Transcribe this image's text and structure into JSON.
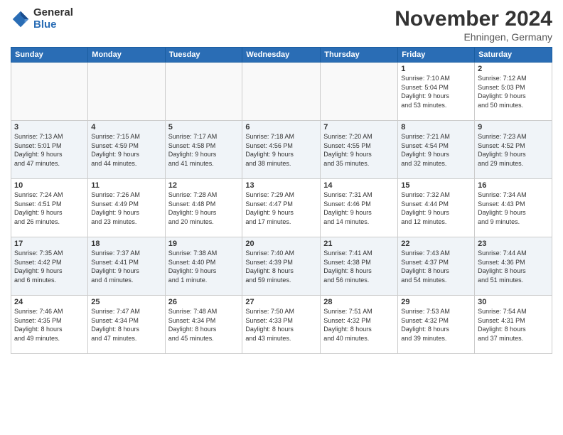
{
  "logo": {
    "general": "General",
    "blue": "Blue"
  },
  "title": "November 2024",
  "location": "Ehningen, Germany",
  "headers": [
    "Sunday",
    "Monday",
    "Tuesday",
    "Wednesday",
    "Thursday",
    "Friday",
    "Saturday"
  ],
  "weeks": [
    {
      "shaded": false,
      "days": [
        {
          "num": "",
          "info": ""
        },
        {
          "num": "",
          "info": ""
        },
        {
          "num": "",
          "info": ""
        },
        {
          "num": "",
          "info": ""
        },
        {
          "num": "",
          "info": ""
        },
        {
          "num": "1",
          "info": "Sunrise: 7:10 AM\nSunset: 5:04 PM\nDaylight: 9 hours\nand 53 minutes."
        },
        {
          "num": "2",
          "info": "Sunrise: 7:12 AM\nSunset: 5:03 PM\nDaylight: 9 hours\nand 50 minutes."
        }
      ]
    },
    {
      "shaded": true,
      "days": [
        {
          "num": "3",
          "info": "Sunrise: 7:13 AM\nSunset: 5:01 PM\nDaylight: 9 hours\nand 47 minutes."
        },
        {
          "num": "4",
          "info": "Sunrise: 7:15 AM\nSunset: 4:59 PM\nDaylight: 9 hours\nand 44 minutes."
        },
        {
          "num": "5",
          "info": "Sunrise: 7:17 AM\nSunset: 4:58 PM\nDaylight: 9 hours\nand 41 minutes."
        },
        {
          "num": "6",
          "info": "Sunrise: 7:18 AM\nSunset: 4:56 PM\nDaylight: 9 hours\nand 38 minutes."
        },
        {
          "num": "7",
          "info": "Sunrise: 7:20 AM\nSunset: 4:55 PM\nDaylight: 9 hours\nand 35 minutes."
        },
        {
          "num": "8",
          "info": "Sunrise: 7:21 AM\nSunset: 4:54 PM\nDaylight: 9 hours\nand 32 minutes."
        },
        {
          "num": "9",
          "info": "Sunrise: 7:23 AM\nSunset: 4:52 PM\nDaylight: 9 hours\nand 29 minutes."
        }
      ]
    },
    {
      "shaded": false,
      "days": [
        {
          "num": "10",
          "info": "Sunrise: 7:24 AM\nSunset: 4:51 PM\nDaylight: 9 hours\nand 26 minutes."
        },
        {
          "num": "11",
          "info": "Sunrise: 7:26 AM\nSunset: 4:49 PM\nDaylight: 9 hours\nand 23 minutes."
        },
        {
          "num": "12",
          "info": "Sunrise: 7:28 AM\nSunset: 4:48 PM\nDaylight: 9 hours\nand 20 minutes."
        },
        {
          "num": "13",
          "info": "Sunrise: 7:29 AM\nSunset: 4:47 PM\nDaylight: 9 hours\nand 17 minutes."
        },
        {
          "num": "14",
          "info": "Sunrise: 7:31 AM\nSunset: 4:46 PM\nDaylight: 9 hours\nand 14 minutes."
        },
        {
          "num": "15",
          "info": "Sunrise: 7:32 AM\nSunset: 4:44 PM\nDaylight: 9 hours\nand 12 minutes."
        },
        {
          "num": "16",
          "info": "Sunrise: 7:34 AM\nSunset: 4:43 PM\nDaylight: 9 hours\nand 9 minutes."
        }
      ]
    },
    {
      "shaded": true,
      "days": [
        {
          "num": "17",
          "info": "Sunrise: 7:35 AM\nSunset: 4:42 PM\nDaylight: 9 hours\nand 6 minutes."
        },
        {
          "num": "18",
          "info": "Sunrise: 7:37 AM\nSunset: 4:41 PM\nDaylight: 9 hours\nand 4 minutes."
        },
        {
          "num": "19",
          "info": "Sunrise: 7:38 AM\nSunset: 4:40 PM\nDaylight: 9 hours\nand 1 minute."
        },
        {
          "num": "20",
          "info": "Sunrise: 7:40 AM\nSunset: 4:39 PM\nDaylight: 8 hours\nand 59 minutes."
        },
        {
          "num": "21",
          "info": "Sunrise: 7:41 AM\nSunset: 4:38 PM\nDaylight: 8 hours\nand 56 minutes."
        },
        {
          "num": "22",
          "info": "Sunrise: 7:43 AM\nSunset: 4:37 PM\nDaylight: 8 hours\nand 54 minutes."
        },
        {
          "num": "23",
          "info": "Sunrise: 7:44 AM\nSunset: 4:36 PM\nDaylight: 8 hours\nand 51 minutes."
        }
      ]
    },
    {
      "shaded": false,
      "days": [
        {
          "num": "24",
          "info": "Sunrise: 7:46 AM\nSunset: 4:35 PM\nDaylight: 8 hours\nand 49 minutes."
        },
        {
          "num": "25",
          "info": "Sunrise: 7:47 AM\nSunset: 4:34 PM\nDaylight: 8 hours\nand 47 minutes."
        },
        {
          "num": "26",
          "info": "Sunrise: 7:48 AM\nSunset: 4:34 PM\nDaylight: 8 hours\nand 45 minutes."
        },
        {
          "num": "27",
          "info": "Sunrise: 7:50 AM\nSunset: 4:33 PM\nDaylight: 8 hours\nand 43 minutes."
        },
        {
          "num": "28",
          "info": "Sunrise: 7:51 AM\nSunset: 4:32 PM\nDaylight: 8 hours\nand 40 minutes."
        },
        {
          "num": "29",
          "info": "Sunrise: 7:53 AM\nSunset: 4:32 PM\nDaylight: 8 hours\nand 39 minutes."
        },
        {
          "num": "30",
          "info": "Sunrise: 7:54 AM\nSunset: 4:31 PM\nDaylight: 8 hours\nand 37 minutes."
        }
      ]
    }
  ]
}
